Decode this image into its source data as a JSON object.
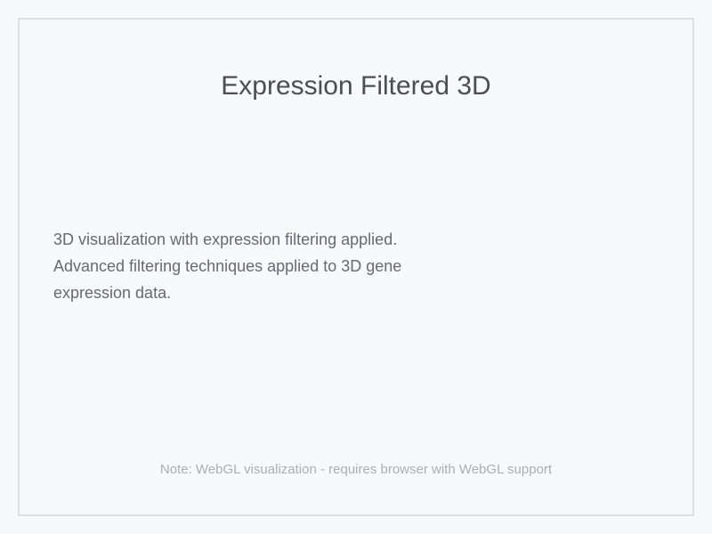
{
  "panel": {
    "title": "Expression Filtered 3D",
    "description": "3D visualization with expression filtering applied. Advanced filtering techniques applied to 3D gene expression data.",
    "note": "Note: WebGL visualization - requires browser with WebGL support"
  }
}
